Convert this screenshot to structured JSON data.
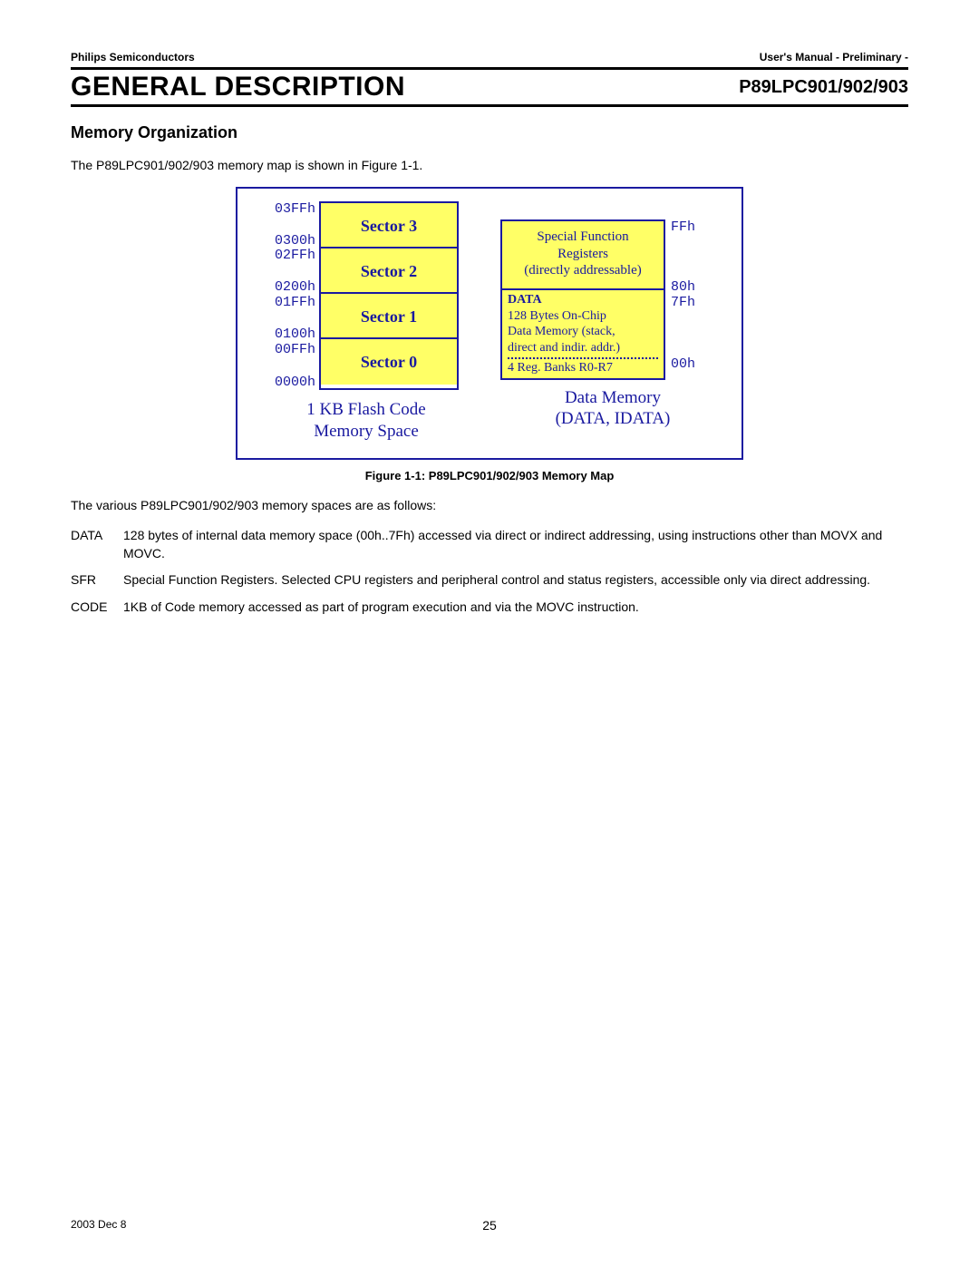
{
  "header": {
    "left": "Philips Semiconductors",
    "right": "User's Manual - Preliminary -"
  },
  "title": {
    "main": "GENERAL DESCRIPTION",
    "part": "P89LPC901/902/903"
  },
  "subhead": "Memory Organization",
  "intro": "The P89LPC901/902/903 memory map is shown in Figure 1-1.",
  "figure": {
    "flash": {
      "sectors": [
        "Sector 3",
        "Sector 2",
        "Sector 1",
        "Sector 0"
      ],
      "addrs": [
        "03FFh",
        "0300h",
        "02FFh",
        "0200h",
        "01FFh",
        "0100h",
        "00FFh",
        "0000h"
      ],
      "caption_l1": "1 KB Flash Code",
      "caption_l2": "Memory Space"
    },
    "data": {
      "sfr_l1": "Special Function",
      "sfr_l2": "Registers",
      "sfr_l3": "(directly addressable)",
      "data_heading": "DATA",
      "data_l1": "128 Bytes On-Chip",
      "data_l2": "Data Memory (stack,",
      "data_l3": "direct and indir. addr.)",
      "data_reg": "4 Reg. Banks R0-R7",
      "addrs": [
        "FFh",
        "80h",
        "7Fh",
        "00h"
      ],
      "caption_l1": "Data Memory",
      "caption_l2": "(DATA, IDATA)"
    },
    "caption": "Figure 1-1: P89LPC901/902/903 Memory Map"
  },
  "spaces_intro": "The various P89LPC901/902/903 memory spaces are as follows:",
  "defs": [
    {
      "term": "DATA",
      "desc": "128 bytes of internal data memory space (00h..7Fh) accessed via direct or indirect addressing, using instructions other than MOVX and MOVC."
    },
    {
      "term": "SFR",
      "desc": "Special Function Registers. Selected CPU registers and peripheral control and status registers, accessible only via direct addressing."
    },
    {
      "term": "CODE",
      "desc": "1KB of Code memory accessed as part of program execution and via the MOVC instruction."
    }
  ],
  "footer": {
    "date": "2003 Dec 8",
    "page": "25"
  }
}
